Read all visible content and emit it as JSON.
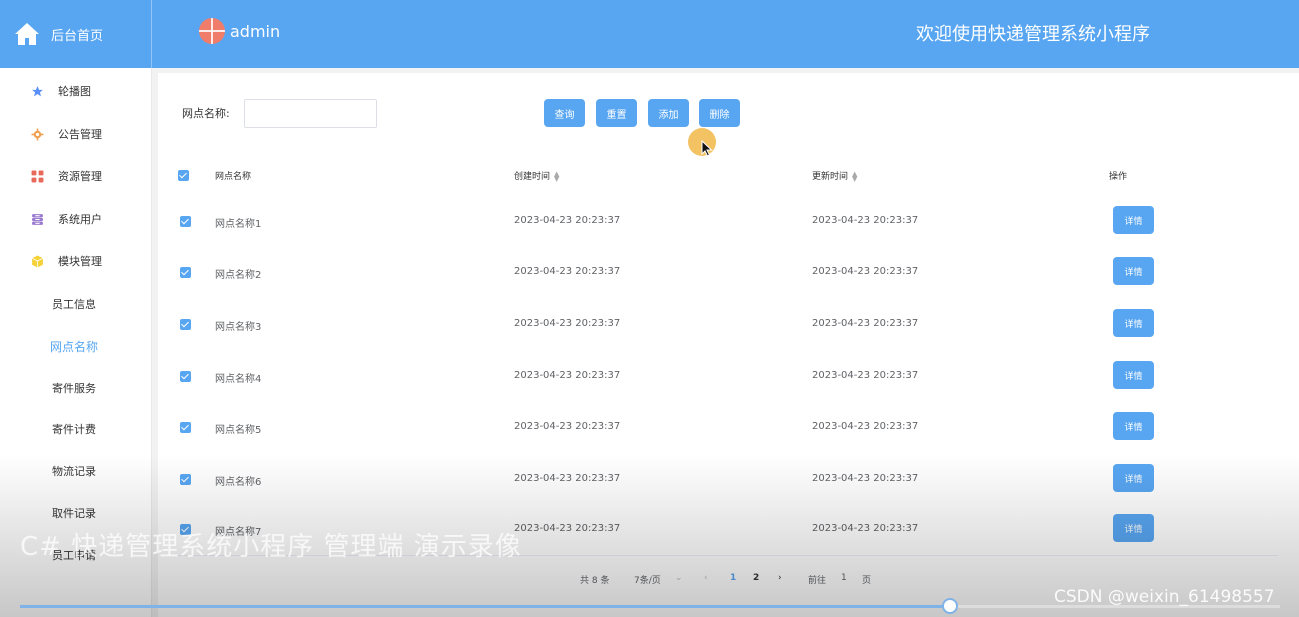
{
  "header": {
    "home_label": "后台首页",
    "username": "admin",
    "welcome": "欢迎使用快递管理系统小程序"
  },
  "sidebar": {
    "items": [
      {
        "label": "轮播图",
        "icon": "star-icon",
        "color": "#5b8ff9"
      },
      {
        "label": "公告管理",
        "icon": "gear-icon",
        "color": "#f0a050"
      },
      {
        "label": "资源管理",
        "icon": "grid-icon",
        "color": "#e8685a"
      },
      {
        "label": "系统用户",
        "icon": "database-icon",
        "color": "#9a7ad0"
      },
      {
        "label": "模块管理",
        "icon": "cube-icon",
        "color": "#f5d13a"
      }
    ],
    "sub_items": [
      "员工信息",
      "网点名称",
      "寄件服务",
      "寄件计费",
      "物流记录",
      "取件记录",
      "员工申请"
    ],
    "active_sub": "网点名称"
  },
  "search": {
    "label": "网点名称:",
    "value": "",
    "buttons": {
      "query": "查询",
      "reset": "重置",
      "add": "添加",
      "delete": "删除"
    }
  },
  "table": {
    "columns": {
      "name": "网点名称",
      "created": "创建时间",
      "updated": "更新时间",
      "actions": "操作"
    },
    "rows": [
      {
        "name": "网点名称1",
        "created": "2023-04-23 20:23:37",
        "updated": "2023-04-23 20:23:37",
        "action": "详情"
      },
      {
        "name": "网点名称2",
        "created": "2023-04-23 20:23:37",
        "updated": "2023-04-23 20:23:37",
        "action": "详情"
      },
      {
        "name": "网点名称3",
        "created": "2023-04-23 20:23:37",
        "updated": "2023-04-23 20:23:37",
        "action": "详情"
      },
      {
        "name": "网点名称4",
        "created": "2023-04-23 20:23:37",
        "updated": "2023-04-23 20:23:37",
        "action": "详情"
      },
      {
        "name": "网点名称5",
        "created": "2023-04-23 20:23:37",
        "updated": "2023-04-23 20:23:37",
        "action": "详情"
      },
      {
        "name": "网点名称6",
        "created": "2023-04-23 20:23:37",
        "updated": "2023-04-23 20:23:37",
        "action": "详情"
      },
      {
        "name": "网点名称7",
        "created": "2023-04-23 20:23:37",
        "updated": "2023-04-23 20:23:37",
        "action": "详情"
      }
    ]
  },
  "pagination": {
    "total": "共 8 条",
    "page_size": "7条/页",
    "pages": [
      "1",
      "2"
    ],
    "current": "1",
    "goto_label": "前往",
    "goto_value": "1",
    "goto_suffix": "页"
  },
  "video": {
    "title": "C# 快递管理系统小程序 管理端 演示录像",
    "progress": 0.738,
    "watermark": "CSDN @weixin_61498557"
  },
  "colors": {
    "primary": "#58a6f2",
    "header": "#58a6f2"
  }
}
